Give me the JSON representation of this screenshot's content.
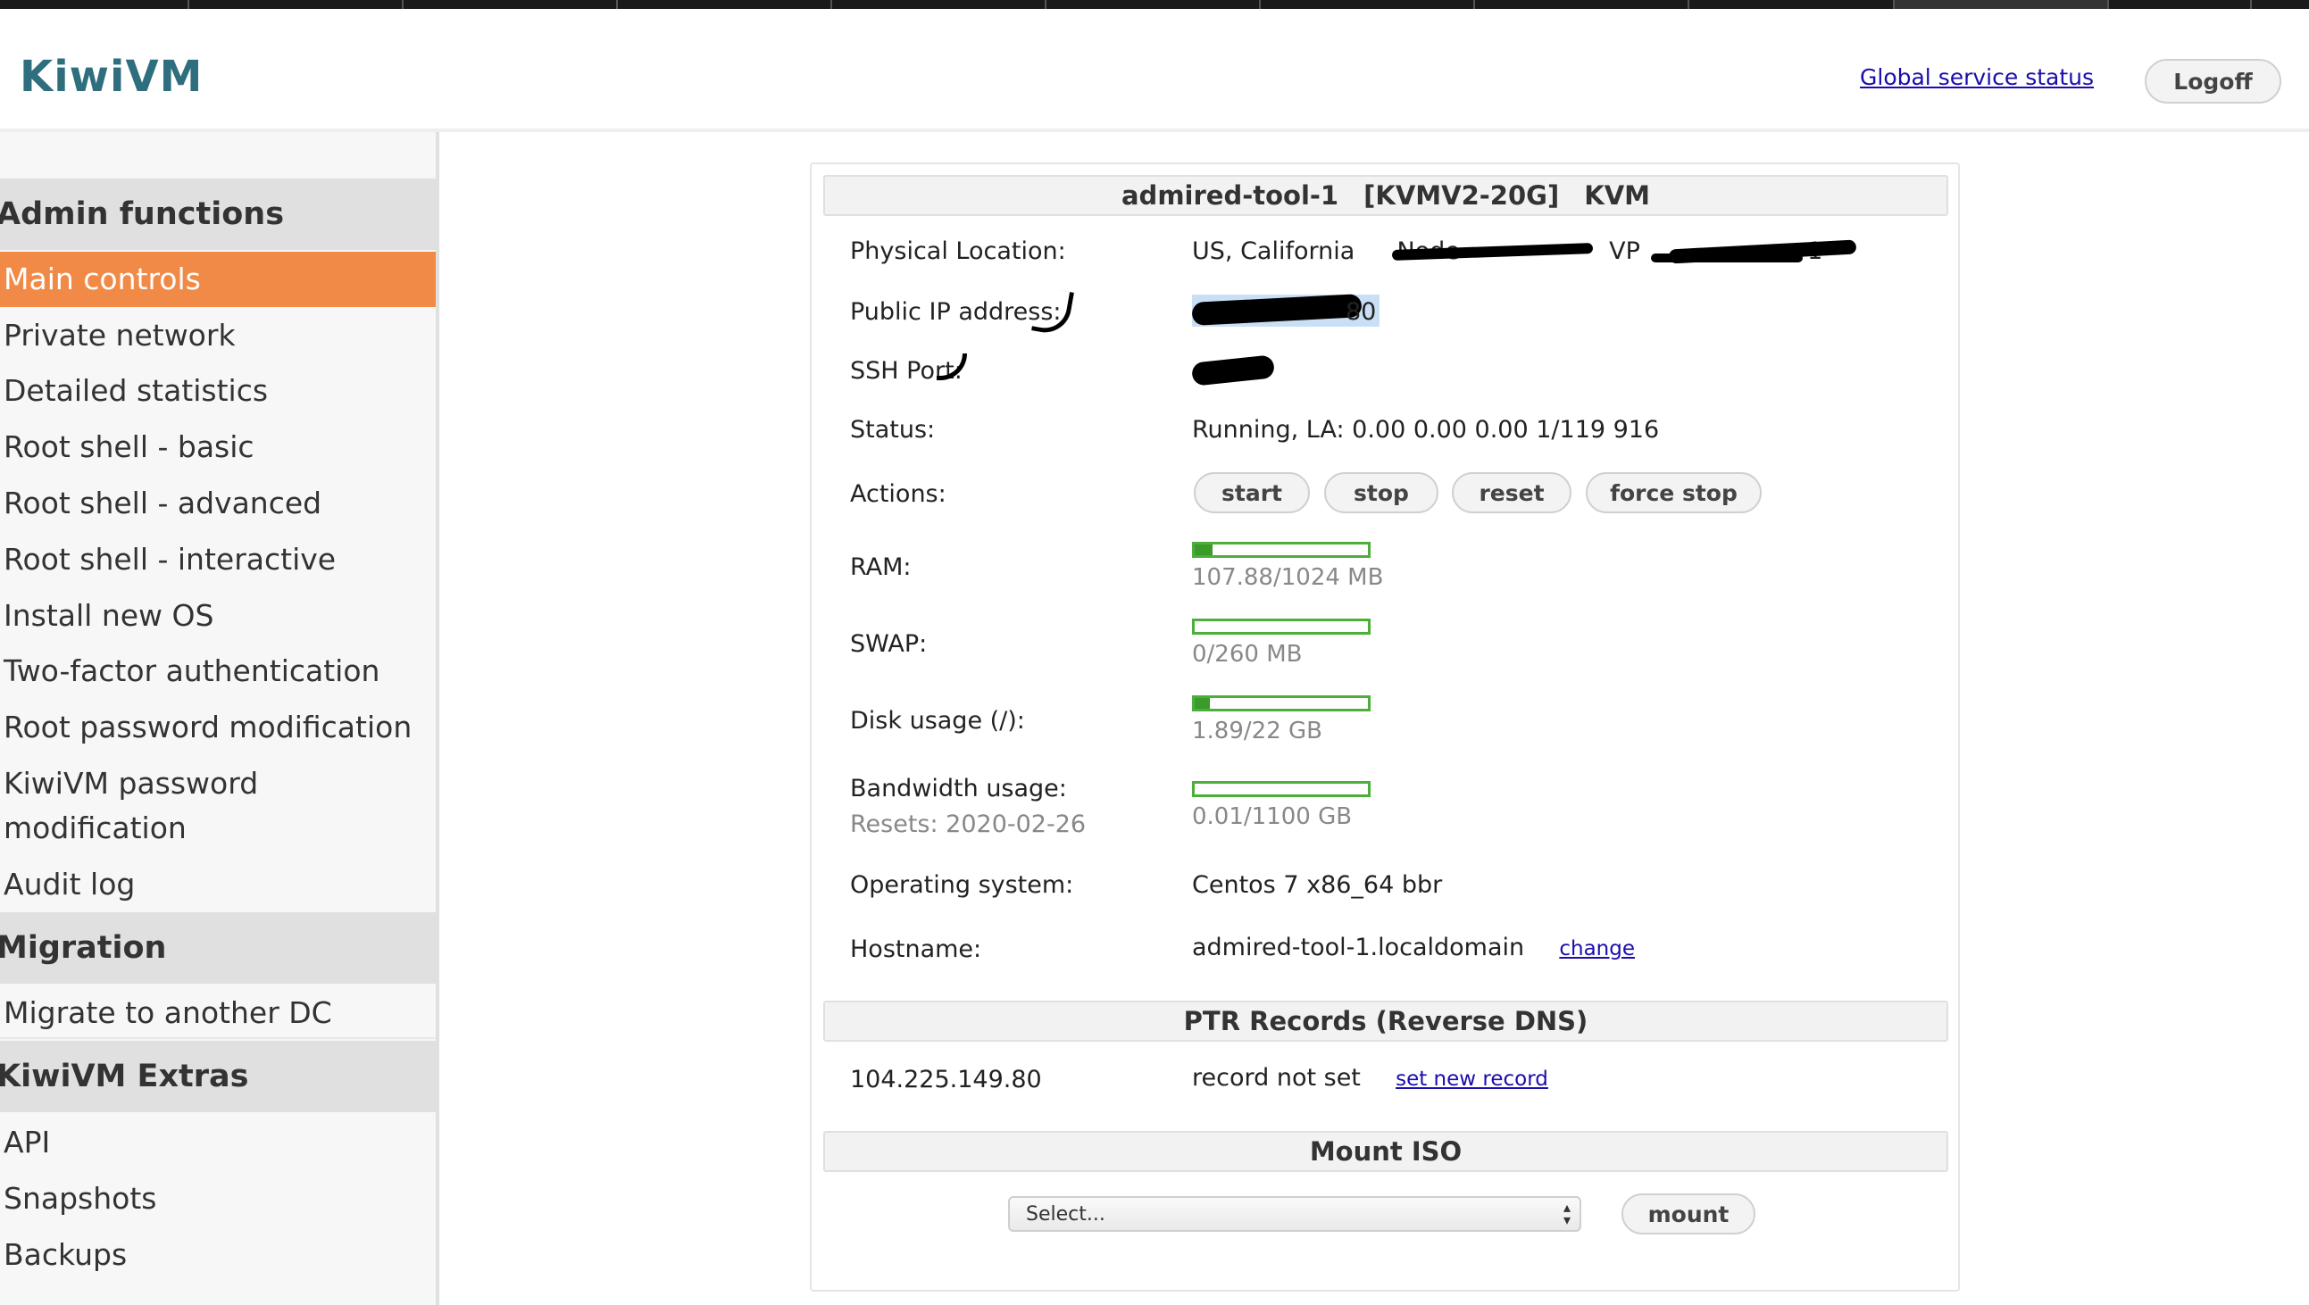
{
  "header": {
    "logo": "KiwiVM",
    "global_status_link": "Global service status",
    "logoff_button": "Logoff"
  },
  "sidebar": {
    "sections": [
      {
        "title": "Admin functions",
        "items": [
          "Main controls",
          "Private network",
          "Detailed statistics",
          "Root shell - basic",
          "Root shell - advanced",
          "Root shell - interactive",
          "Install new OS",
          "Two-factor authentication",
          "Root password modification",
          "KiwiVM password modification",
          "Audit log"
        ]
      },
      {
        "title": "Migration",
        "items": [
          "Migrate to another DC"
        ]
      },
      {
        "title": "KiwiVM Extras",
        "items": [
          "API",
          "Snapshots",
          "Backups"
        ]
      }
    ],
    "active_item": "Main controls",
    "kiwivm_pw_line1": "KiwiVM password",
    "kiwivm_pw_line2": "modification"
  },
  "panel": {
    "title_host": "admired-tool-1",
    "title_plan": "[KVMV2-20G]",
    "title_type": "KVM",
    "rows": {
      "physical_location": {
        "label": "Physical Location:",
        "value": "US, California",
        "node_fragment": "Node",
        "vps_fragment": "VP",
        "trailing": "1"
      },
      "public_ip": {
        "label": "Public IP address:",
        "value_visible": "80"
      },
      "ssh_port": {
        "label": "SSH Port:"
      },
      "status": {
        "label": "Status:",
        "value": "Running, LA: 0.00 0.00 0.00 1/119 916"
      },
      "actions": {
        "label": "Actions:",
        "buttons": [
          "start",
          "stop",
          "reset",
          "force stop"
        ]
      },
      "ram": {
        "label": "RAM:",
        "text": "107.88/1024 MB",
        "fraction": 0.105
      },
      "swap": {
        "label": "SWAP:",
        "text": "0/260 MB",
        "fraction": 0.0
      },
      "disk": {
        "label": "Disk usage (/):",
        "text": "1.89/22 GB",
        "fraction": 0.086
      },
      "bandwidth": {
        "label": "Bandwidth usage:",
        "reset_note": "Resets: 2020-02-26",
        "text": "0.01/1100 GB",
        "fraction": 0.0
      },
      "os": {
        "label": "Operating system:",
        "value": "Centos 7 x86_64 bbr"
      },
      "hostname": {
        "label": "Hostname:",
        "value": "admired-tool-1.localdomain",
        "change_link": "change"
      }
    },
    "ptr": {
      "title": "PTR Records (Reverse DNS)",
      "ip": "104.225.149.80",
      "status": "record not set",
      "link": "set new record"
    },
    "iso": {
      "title": "Mount ISO",
      "select_value": "Select...",
      "mount_button": "mount"
    }
  },
  "colors": {
    "accent": "#f28a47",
    "meter_green": "#4caf3a",
    "link_blue": "#1a0dab",
    "logo_teal": "#2e6e7e"
  }
}
